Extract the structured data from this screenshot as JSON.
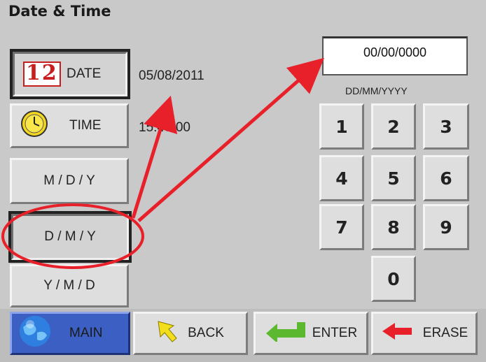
{
  "title": "Date & Time",
  "left_buttons": {
    "date": {
      "label": "DATE",
      "icon_text": "12"
    },
    "time": {
      "label": "TIME"
    },
    "mdy": {
      "label": "M / D / Y"
    },
    "dmy": {
      "label": "D / M / Y"
    },
    "ymd": {
      "label": "Y / M / D"
    }
  },
  "values": {
    "date": "05/08/2011",
    "time": "15:48:00"
  },
  "entry": {
    "display": "00/00/0000",
    "format": "DD/MM/YYYY"
  },
  "keypad": [
    "1",
    "2",
    "3",
    "4",
    "5",
    "6",
    "7",
    "8",
    "9",
    "0"
  ],
  "bottom": {
    "main": "MAIN",
    "back": "BACK",
    "enter": "ENTER",
    "erase": "ERASE"
  },
  "colors": {
    "annotation": "#e8202a",
    "main_button": "#3c5fc4",
    "enter_arrow": "#5cb82e",
    "erase_arrow": "#e8202a",
    "back_arrow": "#f2de1a"
  },
  "icons": {
    "date": "calendar-icon",
    "time": "clock-icon",
    "main": "globe-icon",
    "back": "back-arrow-icon",
    "enter": "enter-arrow-icon",
    "erase": "erase-arrow-icon"
  }
}
